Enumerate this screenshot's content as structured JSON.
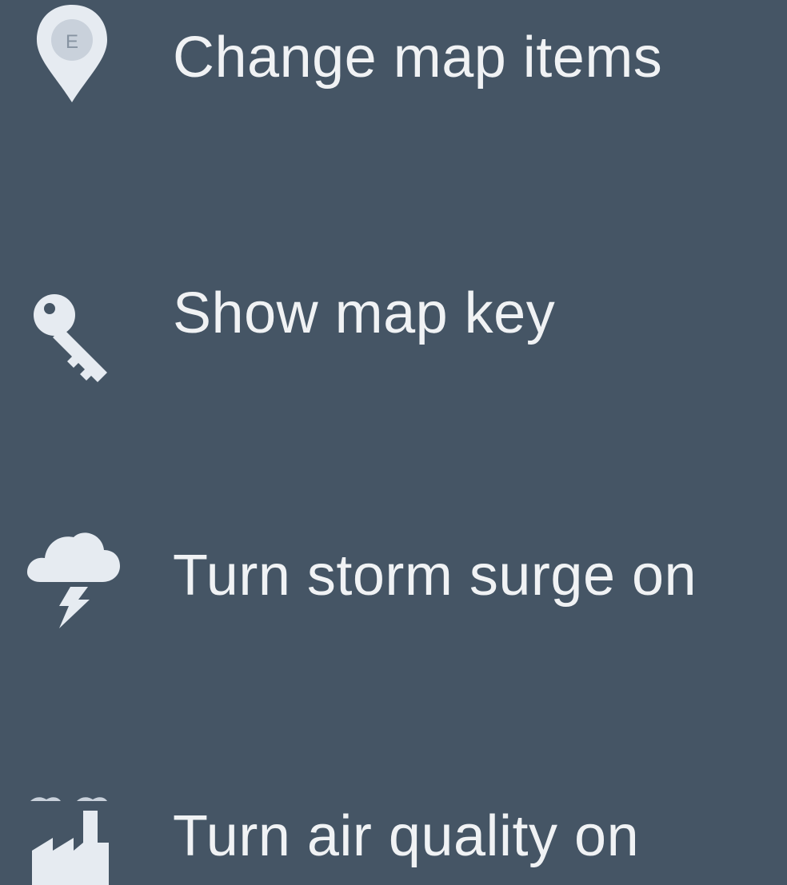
{
  "menu": {
    "items": [
      {
        "label": "Change map items",
        "icon": "map-marker-icon"
      },
      {
        "label": "Show map key",
        "icon": "key-icon"
      },
      {
        "label": "Turn storm surge on",
        "icon": "storm-cloud-icon"
      },
      {
        "label": "Turn air quality on",
        "icon": "factory-icon"
      }
    ]
  },
  "colors": {
    "background": "#455565",
    "text": "#f0f2f4",
    "icon": "#e6ebf1"
  }
}
